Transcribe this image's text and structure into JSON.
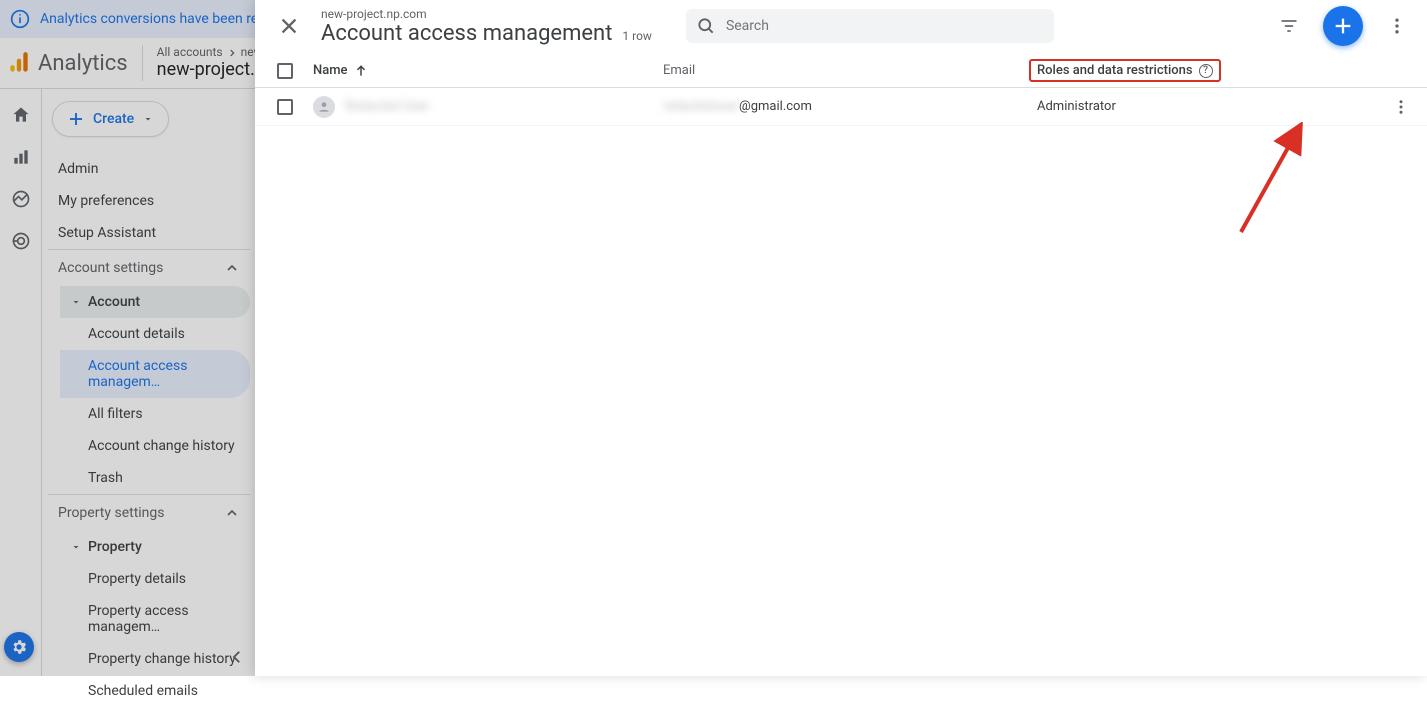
{
  "infobar": {
    "text": "Analytics conversions have been rename"
  },
  "header": {
    "product": "Analytics",
    "crumb_all": "All accounts",
    "crumb_project": "new-project",
    "property_title": "new-project.n…"
  },
  "sidebar": {
    "create": "Create",
    "items": {
      "admin": "Admin",
      "myprefs": "My preferences",
      "setup": "Setup Assistant"
    },
    "account_settings_hdr": "Account settings",
    "account_tree": "Account",
    "account_children": {
      "details": "Account details",
      "access": "Account access managem…",
      "filters": "All filters",
      "history": "Account change history",
      "trash": "Trash"
    },
    "property_settings_hdr": "Property settings",
    "property_tree": "Property",
    "property_children": {
      "details": "Property details",
      "access": "Property access managem…",
      "history": "Property change history",
      "emails": "Scheduled emails"
    }
  },
  "panel": {
    "subtitle": "new-project.np.com",
    "title": "Account access management",
    "row_count": "1 row",
    "search_placeholder": "Search",
    "columns": {
      "name": "Name",
      "email": "Email",
      "roles": "Roles and data restrictions"
    },
    "rows": [
      {
        "name_hidden": "Redacted User",
        "email_hidden": "redacteduser",
        "email_domain": "@gmail.com",
        "role": "Administrator"
      }
    ]
  }
}
